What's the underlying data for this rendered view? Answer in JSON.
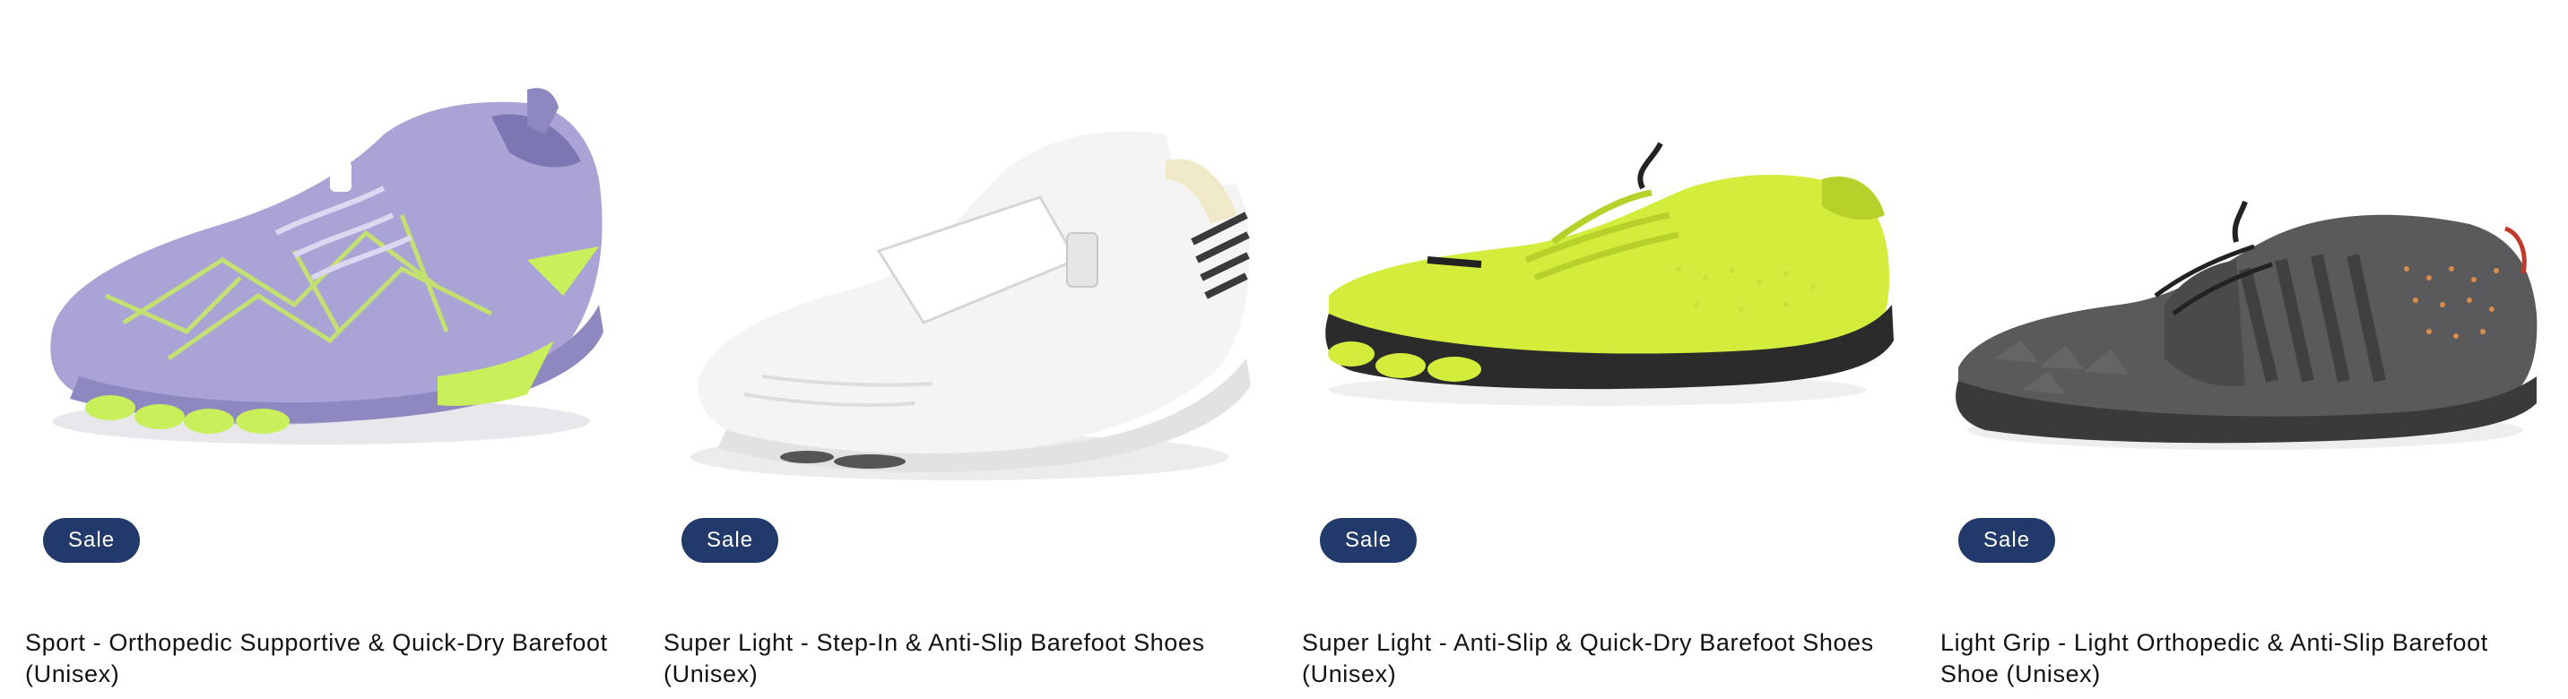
{
  "products": [
    {
      "title": "Sport - Orthopedic Supportive & Quick-Dry Barefoot (Unisex)",
      "badge": "Sale",
      "image": {
        "icon": "shoe-image",
        "upper_color": "#a9a3d6",
        "accent_color": "#c9ef5a",
        "sole_color": "#8e88c0"
      }
    },
    {
      "title": "Super Light - Step-In & Anti-Slip Barefoot Shoes (Unisex)",
      "badge": "Sale",
      "image": {
        "icon": "shoe-image",
        "upper_color": "#f1f1f1",
        "accent_color": "#3a3a3a",
        "sole_color": "#e2e2e2"
      }
    },
    {
      "title": "Super Light - Anti-Slip & Quick-Dry Barefoot Shoes (Unisex)",
      "badge": "Sale",
      "image": {
        "icon": "shoe-image",
        "upper_color": "#d4ec3c",
        "accent_color": "#b8d12a",
        "sole_color": "#2b2b2b"
      }
    },
    {
      "title": "Light Grip - Light Orthopedic & Anti-Slip Barefoot Shoe (Unisex)",
      "badge": "Sale",
      "image": {
        "icon": "shoe-image",
        "upper_color": "#5a5a5c",
        "accent_color": "#d98b4a",
        "sole_color": "#3a3a3c"
      }
    }
  ],
  "colors": {
    "badge_background": "#223a6b",
    "badge_text": "#ffffff",
    "title_text": "#121212"
  }
}
